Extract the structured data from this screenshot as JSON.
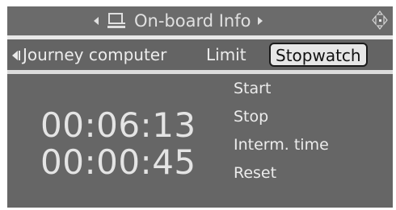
{
  "header": {
    "title": "On-board Info",
    "left_icon": "computer-icon",
    "right_icon": "controller-icon"
  },
  "tabs": {
    "items": [
      {
        "label": "Journey computer"
      },
      {
        "label": "Limit"
      },
      {
        "label": "Stopwatch",
        "selected": true
      }
    ]
  },
  "stopwatch": {
    "time_primary": "00:06:13",
    "time_secondary": "00:00:45"
  },
  "menu": {
    "items": [
      {
        "label": "Start"
      },
      {
        "label": "Stop"
      },
      {
        "label": "Interm. time"
      },
      {
        "label": "Reset"
      }
    ]
  },
  "colors": {
    "background": "#666666",
    "text": "#e8e8e8",
    "selected_tab_bg": "#e6e6e6",
    "separator": "#e8e8e8"
  }
}
